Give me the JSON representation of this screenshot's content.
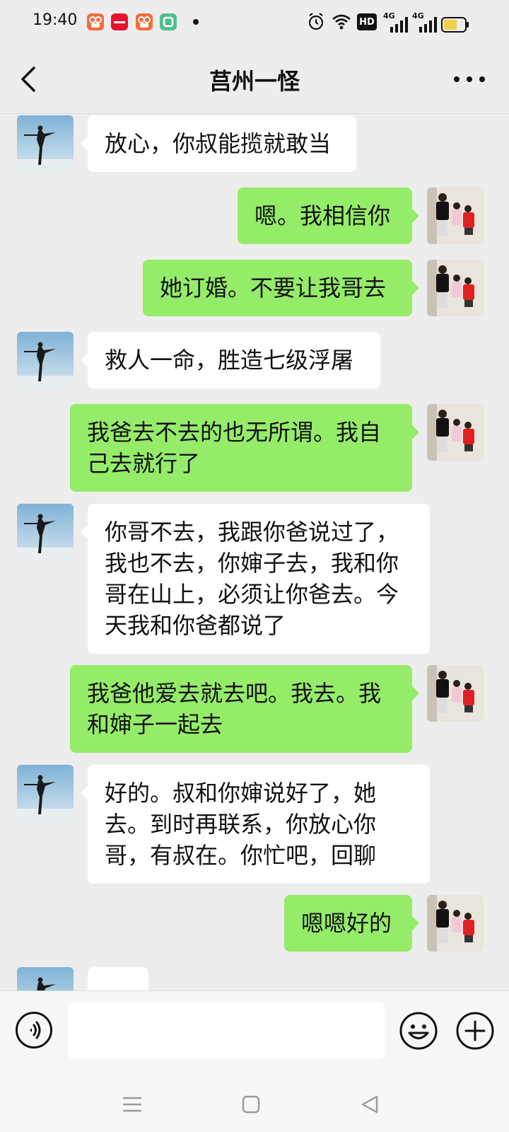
{
  "status_bar": {
    "time": "19:40",
    "app_icons": [
      {
        "name": "kuaishou-icon",
        "color": "#f46b3c",
        "glyph": "◎"
      },
      {
        "name": "app-red-icon",
        "color": "#e8112d",
        "glyph": "一"
      },
      {
        "name": "kuaishou-icon-2",
        "color": "#f46b3c",
        "glyph": "◎"
      },
      {
        "name": "app-green-icon",
        "color": "#4fc08d",
        "glyph": "▢"
      }
    ],
    "network_labels": {
      "hd": "HD",
      "sim1": "4G",
      "sim2": "4G"
    },
    "battery_color": "#f3d04a"
  },
  "header": {
    "title": "莒州一怪"
  },
  "messages": [
    {
      "side": "in",
      "text": "放心，你叔能揽就敢当"
    },
    {
      "side": "out",
      "text": "嗯。我相信你"
    },
    {
      "side": "out",
      "text": "她订婚。不要让我哥去"
    },
    {
      "side": "in",
      "text": "救人一命，胜造七级浮屠"
    },
    {
      "side": "out",
      "text": "我爸去不去的也无所谓。我自己去就行了"
    },
    {
      "side": "in",
      "text": "你哥不去，我跟你爸说过了，我也不去，你婶子去，我和你哥在山上，必须让你爸去。今天我和你爸都说了"
    },
    {
      "side": "out",
      "text": "我爸他爱去就去吧。我去。我和婶子一起去"
    },
    {
      "side": "in",
      "text": "好的。叔和你婶说好了，她去。到时再联系，你放心你哥，有叔在。你忙吧，回聊"
    },
    {
      "side": "out",
      "text": "嗯嗯好的"
    },
    {
      "side": "in",
      "text": ""
    }
  ],
  "input": {
    "value": "",
    "placeholder": ""
  },
  "colors": {
    "outgoing_bubble": "#95ec69",
    "incoming_bubble": "#ffffff",
    "background": "#ededed"
  },
  "icons": {
    "back": "chevron-left-icon",
    "more": "more-dots-icon",
    "voice": "voice-icon",
    "emoji": "emoji-icon",
    "plus": "plus-icon"
  }
}
